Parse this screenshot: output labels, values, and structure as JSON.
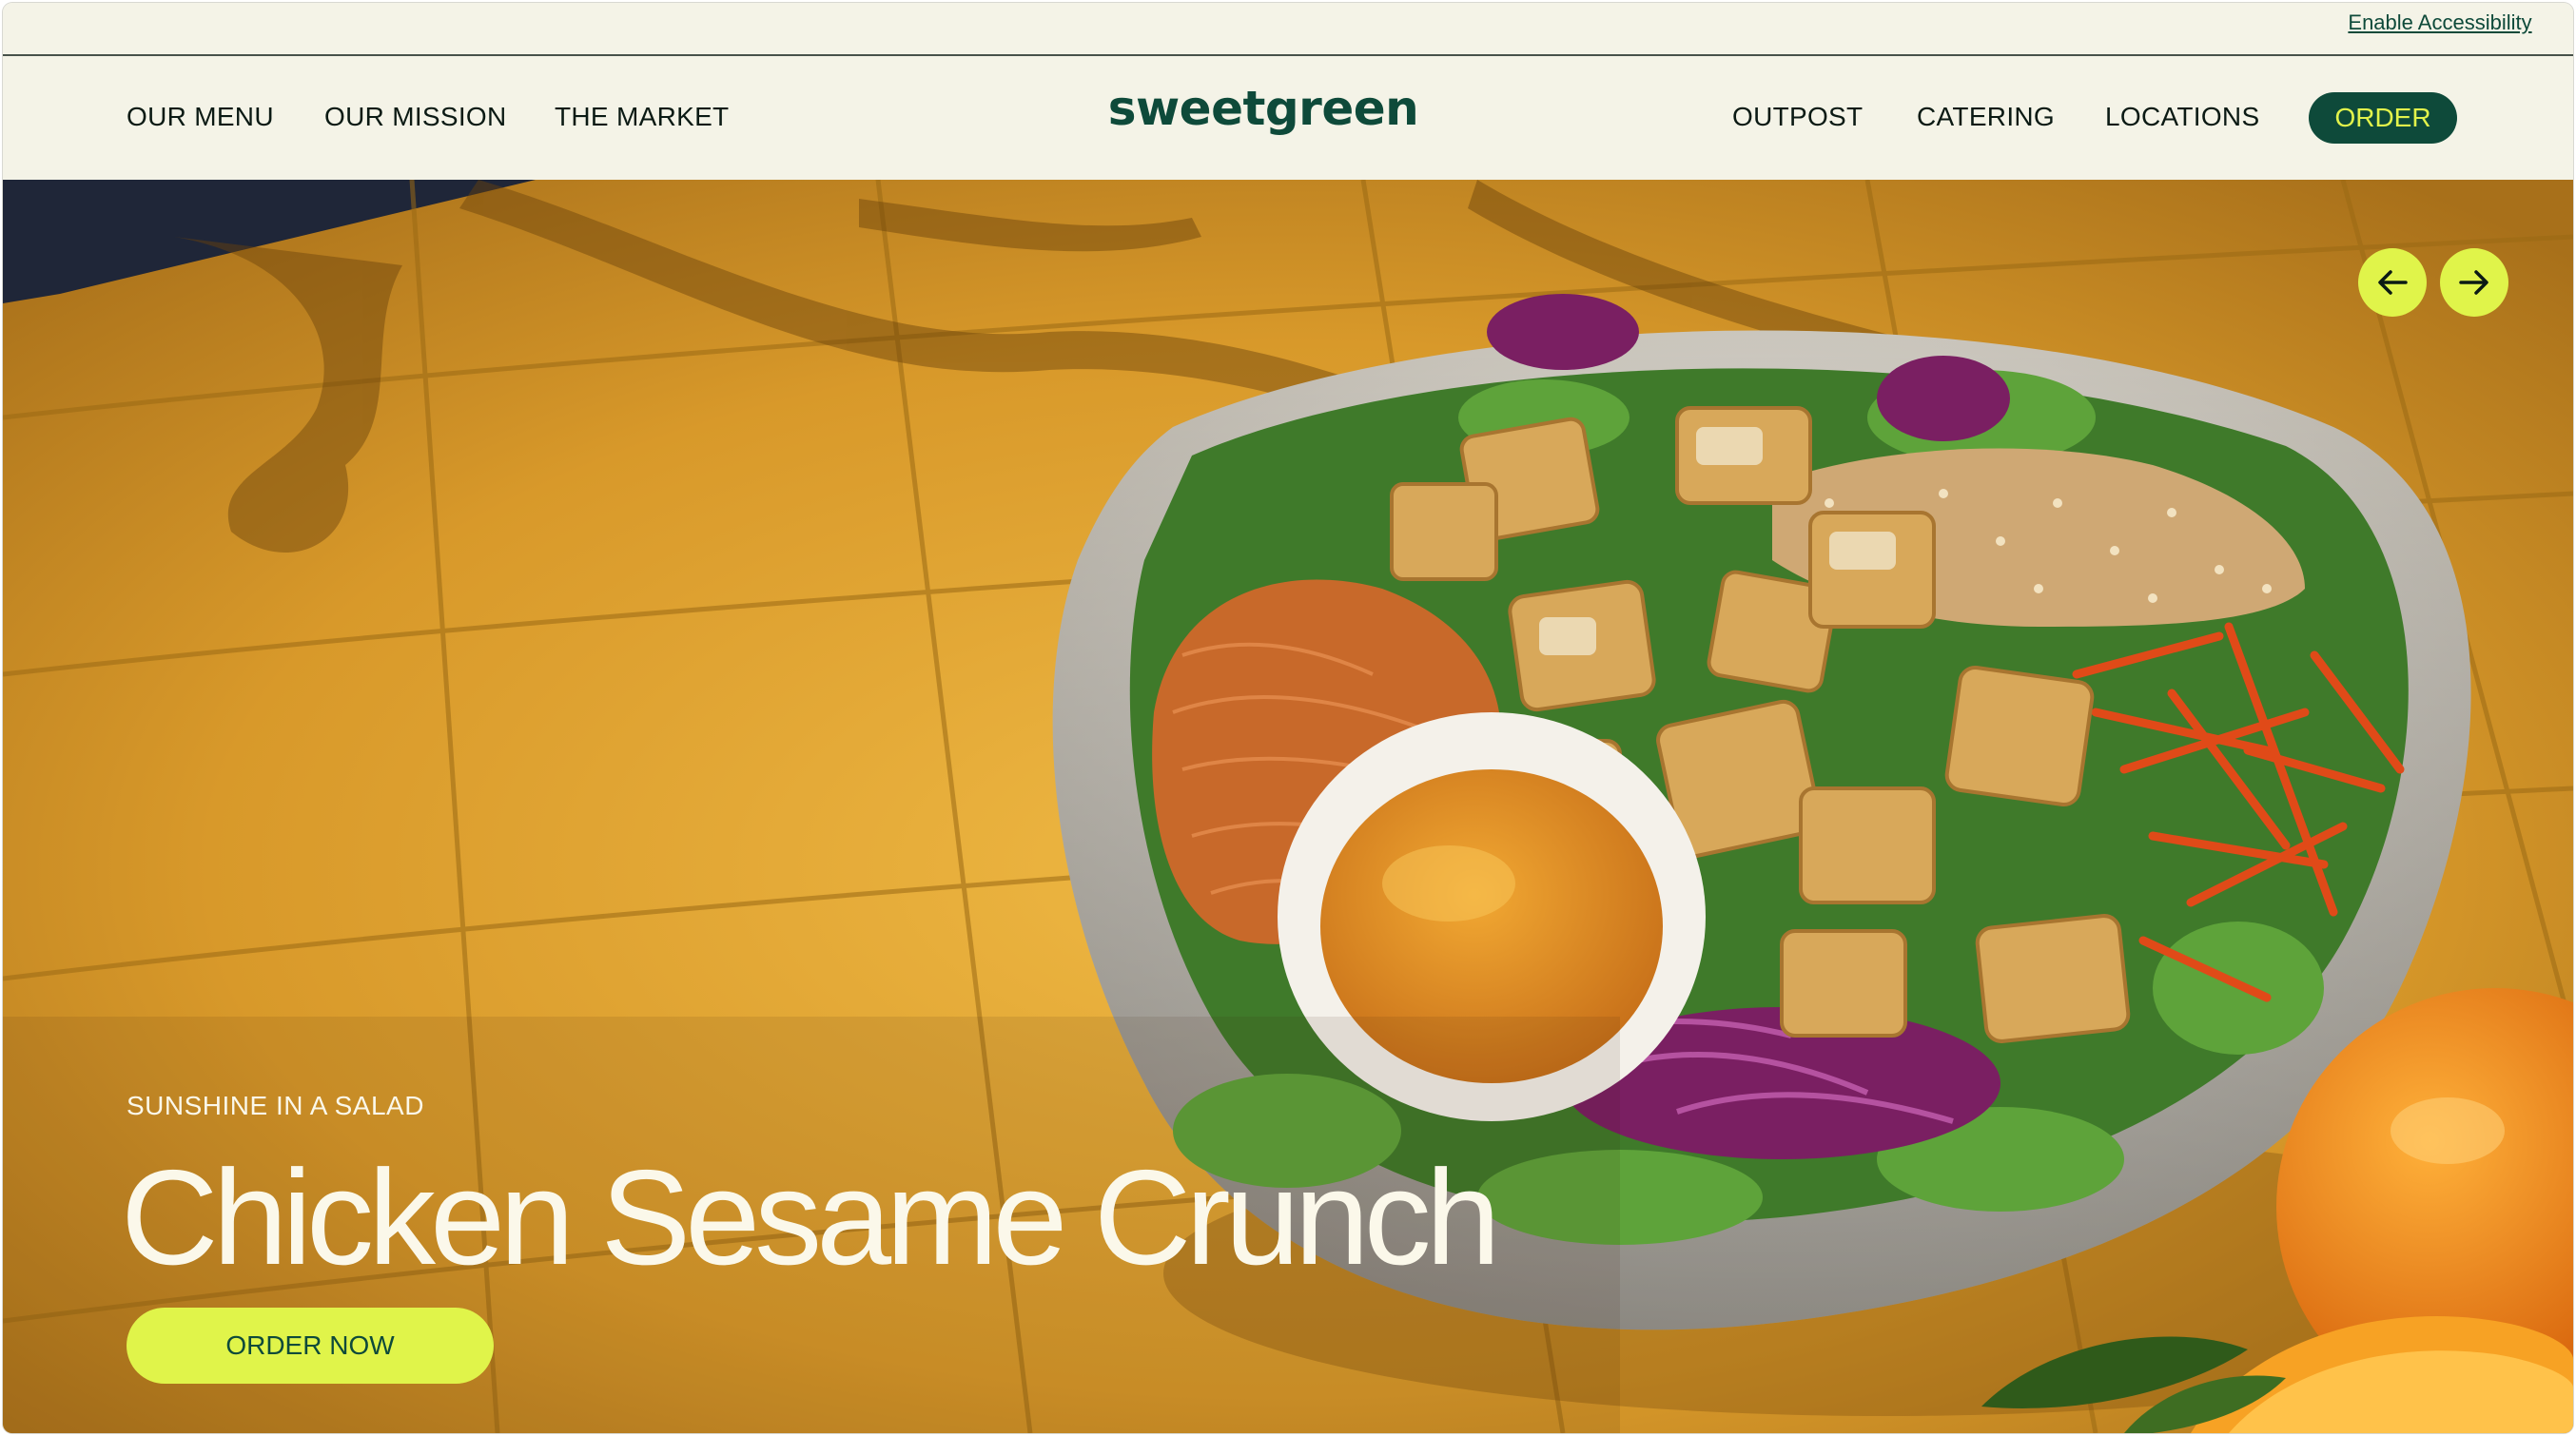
{
  "utility": {
    "accessibility_link": "Enable Accessibility"
  },
  "nav": {
    "left_items": [
      "OUR MENU",
      "OUR MISSION",
      "THE MARKET"
    ],
    "right_items": [
      "OUTPOST",
      "CATERING",
      "LOCATIONS"
    ],
    "order_label": "ORDER",
    "logo_text": "sweetgreen"
  },
  "hero": {
    "eyebrow": "SUNSHINE IN A SALAD",
    "title": "Chicken Sesame Crunch",
    "cta_label": "ORDER NOW",
    "prev_icon": "arrow-left-icon",
    "next_icon": "arrow-right-icon"
  },
  "colors": {
    "brand_green": "#0e4a3a",
    "accent_lime": "#e0f44a",
    "cream": "#f4f3e7"
  }
}
